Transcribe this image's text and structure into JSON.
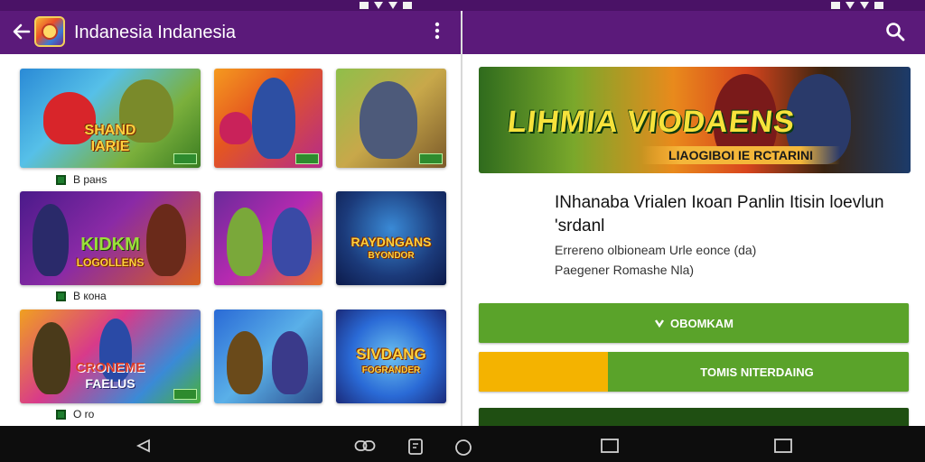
{
  "left_app": {
    "title": "Indanesia Indanesia",
    "back_icon": "back-arrow-icon",
    "menu_icon": "more-vert-icon"
  },
  "right_app": {
    "search_icon": "search-icon"
  },
  "grid": {
    "tiles": [
      {
        "title_line1": "SHAND",
        "title_line2": "IARIE"
      },
      {
        "title_line1": "",
        "title_line2": ""
      },
      {
        "title_line1": "",
        "title_line2": ""
      },
      {
        "title_line1": "KIDKM",
        "title_line2": "LOGOLLENS"
      },
      {
        "title_line1": "",
        "title_line2": ""
      },
      {
        "title_line1": "RAYDNGANS",
        "title_line2": "BYONDOR"
      },
      {
        "title_line1": "CRONEME",
        "title_line2": "FAELUS"
      },
      {
        "title_line1": "",
        "title_line2": ""
      },
      {
        "title_line1": "SIVDANG",
        "title_line2": "FOGRANDER"
      }
    ],
    "row_labels": [
      "B ранs",
      "B кона",
      "O ro"
    ]
  },
  "detail": {
    "banner_title": "LIHMIA VIODAENS",
    "banner_subtitle": "LIAOGIBOI IE RCTARINI",
    "title": "INhanaba Vrialen Ікоап Panlin Itisin loevlun 'srdanl",
    "meta_line1": "Errereno olbioneam Urle eonce (da)",
    "meta_line2": "Paegener Romashe Nla)",
    "download_label": "OBOMKAM",
    "second_label": "TOMIS NITERDAING",
    "second_progress": 0.3
  },
  "colors": {
    "app_bar": "#5b1a7a",
    "status_bar": "#4a1266",
    "button_green": "#5aa32a",
    "progress_yellow": "#f4b300"
  }
}
